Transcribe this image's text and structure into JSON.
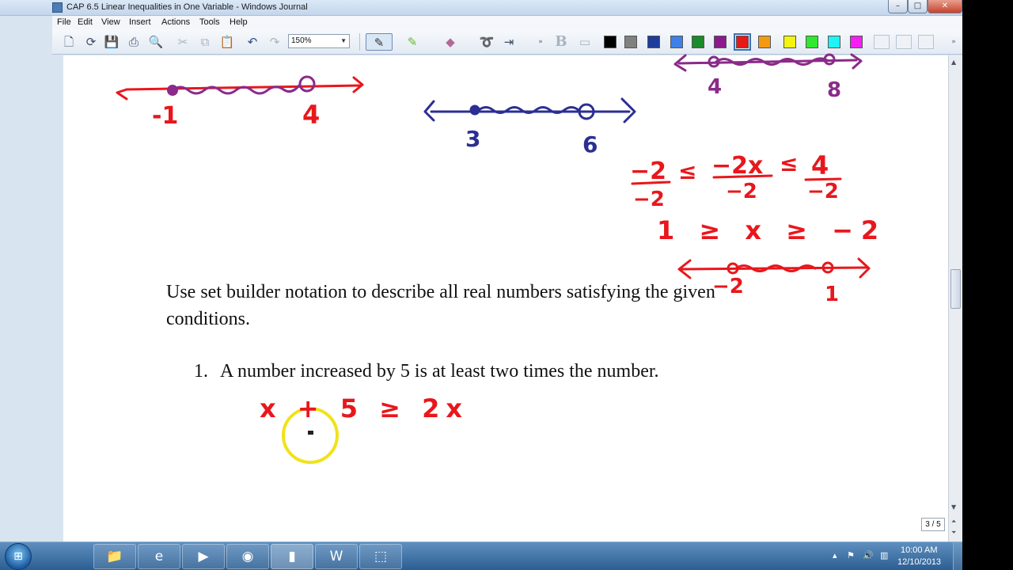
{
  "window": {
    "title": "CAP 6.5 Linear Inequalities in One Variable - Windows Journal",
    "min_label": "–",
    "max_label": "□",
    "close_label": "✕"
  },
  "menu": {
    "items": [
      {
        "label": "File"
      },
      {
        "label": "Edit"
      },
      {
        "label": "View"
      },
      {
        "label": "Insert"
      },
      {
        "label": "Actions"
      },
      {
        "label": "Tools"
      },
      {
        "label": "Help"
      }
    ]
  },
  "toolbar": {
    "zoom_value": "150%",
    "bold_label": "B",
    "colors": {
      "black": "#000000",
      "gray": "#808080",
      "navy": "#1f3c9a",
      "blue": "#3f7fe8",
      "green": "#1b8a2a",
      "purple": "#8b1a8b",
      "red": "#e81818",
      "orange": "#f39a12",
      "yellow": "#f3f312",
      "lime": "#2fe82f",
      "cyan": "#1ff3f3",
      "magenta": "#f31ff3"
    },
    "selected_color": "red"
  },
  "document": {
    "prompt_line1": "Use set builder notation to describe all real numbers satisfying the given",
    "prompt_line2": "conditions.",
    "problem1_number": "1.",
    "problem1_text": "A number increased by 5 is at least two times the number.",
    "ink_colors": {
      "red": "#e8171c",
      "navy": "#2b2f93",
      "purple": "#8a2a8a",
      "highlighter": "#f1e21a"
    },
    "handwriting": {
      "nl1_left": "-1",
      "nl1_right": "4",
      "nl2_left": "3",
      "nl2_right": "6",
      "nl3_left": "4",
      "nl3_right": "8",
      "div_numerators": [
        "−2",
        "≤",
        "−2x",
        "≤",
        "4"
      ],
      "div_denominators": [
        "−2",
        "−2",
        "−2"
      ],
      "result_inequality": "1 ≥ x ≥ −2",
      "nl4_left": "−2",
      "nl4_right": "1",
      "problem1_work": "x + 5 ≥ 2x"
    }
  },
  "page_nav": {
    "label": "3 / 5"
  },
  "taskbar": {
    "apps": [
      {
        "name": "explorer",
        "icon": "folder-icon"
      },
      {
        "name": "internet-explorer",
        "icon": "ie-icon"
      },
      {
        "name": "media-player",
        "icon": "media-icon"
      },
      {
        "name": "chrome",
        "icon": "chrome-icon"
      },
      {
        "name": "journal",
        "icon": "journal-icon"
      },
      {
        "name": "word",
        "icon": "word-icon"
      },
      {
        "name": "snipping-tool",
        "icon": "snip-icon"
      }
    ],
    "clock_time": "10:00 AM",
    "clock_date": "12/10/2013"
  }
}
